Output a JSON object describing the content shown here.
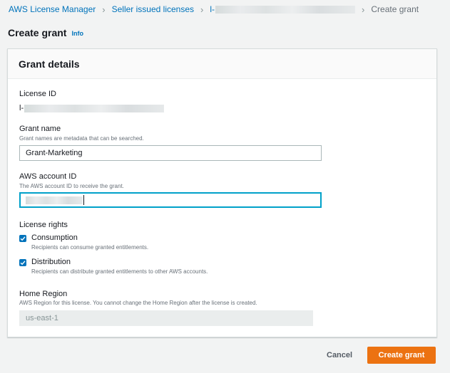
{
  "breadcrumb": {
    "items": [
      "AWS License Manager",
      "Seller issued licenses",
      "l-",
      "Create grant"
    ]
  },
  "page": {
    "title": "Create grant",
    "info_label": "Info"
  },
  "panel": {
    "title": "Grant details"
  },
  "license_id": {
    "label": "License ID",
    "value_prefix": "l-"
  },
  "grant_name": {
    "label": "Grant name",
    "description": "Grant names are metadata that can be searched.",
    "value": "Grant-Marketing"
  },
  "account_id": {
    "label": "AWS account ID",
    "description": "The AWS account ID to receive the grant."
  },
  "license_rights": {
    "label": "License rights",
    "options": [
      {
        "label": "Consumption",
        "description": "Recipients can consume granted entitlements.",
        "checked": true
      },
      {
        "label": "Distribution",
        "description": "Recipients can distribute granted entitlements to other AWS accounts.",
        "checked": true
      }
    ]
  },
  "home_region": {
    "label": "Home Region",
    "description": "AWS Region for this license. You cannot change the Home Region after the license is created.",
    "value": "us-east-1"
  },
  "actions": {
    "cancel_label": "Cancel",
    "create_label": "Create grant"
  },
  "colors": {
    "link": "#0073bb",
    "primary_button": "#ec7211",
    "checkbox": "#0073bb",
    "focus_border": "#00a1c9"
  }
}
